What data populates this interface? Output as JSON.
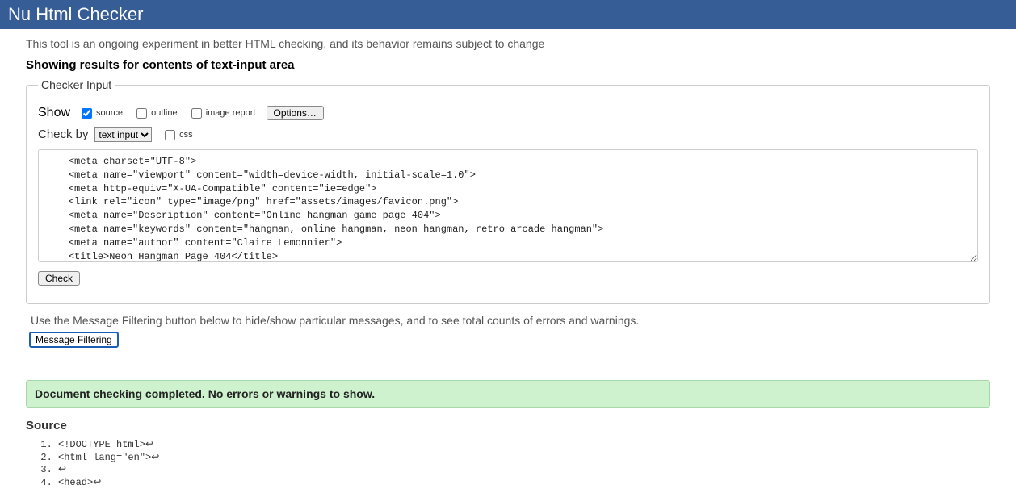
{
  "header": {
    "title": "Nu Html Checker"
  },
  "experiment_note": "This tool is an ongoing experiment in better HTML checking, and its behavior remains subject to change",
  "results_heading": "Showing results for contents of text-input area",
  "checker": {
    "legend": "Checker Input",
    "show_label": "Show",
    "cb_source": "source",
    "cb_outline": "outline",
    "cb_image_report": "image report",
    "options_button": "Options…",
    "checkby_label": "Check by",
    "checkby_selected": "text input",
    "cb_css": "css",
    "textarea_value": "    <meta charset=\"UTF-8\">\n    <meta name=\"viewport\" content=\"width=device-width, initial-scale=1.0\">\n    <meta http-equiv=\"X-UA-Compatible\" content=\"ie=edge\">\n    <link rel=\"icon\" type=\"image/png\" href=\"assets/images/favicon.png\">\n    <meta name=\"Description\" content=\"Online hangman game page 404\">\n    <meta name=\"keywords\" content=\"hangman, online hangman, neon hangman, retro arcade hangman\">\n    <meta name=\"author\" content=\"Claire Lemonnier\">\n    <title>Neon Hangman Page 404</title>\n    <link rel=\"stylesheet\" href=\"assets/css/style.css\">\n</head>",
    "check_button": "Check"
  },
  "filter_note": "Use the Message Filtering button below to hide/show particular messages, and to see total counts of errors and warnings.",
  "message_filtering_button": "Message Filtering",
  "success_message": "Document checking completed. No errors or warnings to show.",
  "source_heading": "Source",
  "source_lines": {
    "l1": "<!DOCTYPE html>↩",
    "l2": "<html lang=\"en\">↩",
    "l3": "↩",
    "l4": "<head>↩"
  }
}
